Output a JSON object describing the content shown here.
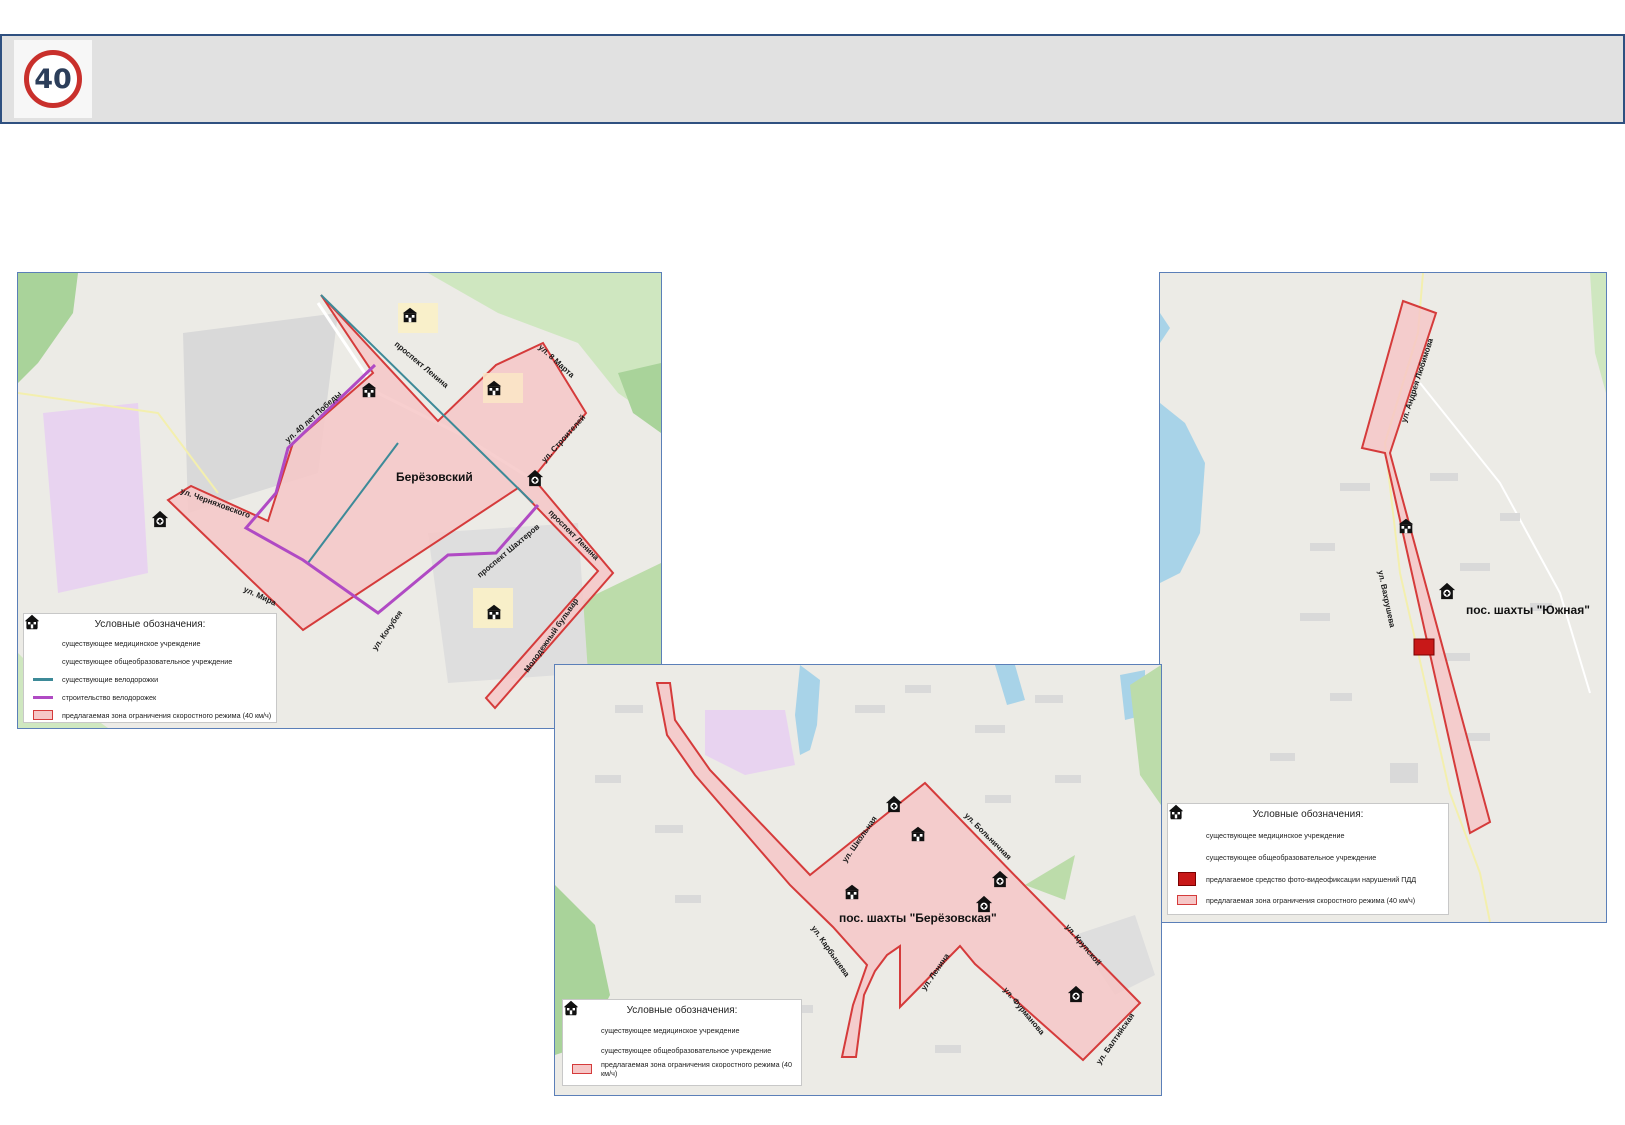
{
  "header": {
    "badge_number": "40",
    "accent_color": "#2f5080",
    "badge_color": "#c9302c"
  },
  "maps": {
    "berezovsky": {
      "place_name": "Берёзовский",
      "streets": {
        "prospekt_lenina_1": "проспект Ленина",
        "ul_8_marta": "ул. 8 Марта",
        "ul_40_let_pobedy": "ул. 40 лет Победы",
        "ul_stroiteley": "ул. Строителей",
        "ul_chernyakhovskogo": "ул. Черняховского",
        "prospekt_lenina_2": "проспект Ленина",
        "prospekt_shakhterov": "проспект Шахтеров",
        "ul_mira": "ул. Мира",
        "ul_kochubeya": "ул. Кочубея",
        "molodezhny_bulvar": "Молодежный бульвар"
      },
      "legend": {
        "title": "Условные обозначения:",
        "medical": "существующее медицинское учреждение",
        "school": "существующее общеобразовательное учреждение",
        "bike_existing": "существующие велодорожки",
        "bike_construction": "строительство велодорожек",
        "zone": "предлагаемая зона ограничения скоростного режима (40 км/ч)"
      }
    },
    "berezovskaya": {
      "place_name": "пос. шахты \"Берёзовская\"",
      "streets": {
        "ul_shkolnaya": "ул. Школьная",
        "ul_bolnichnaya": "ул. Больничная",
        "ul_karbysheva": "ул. Карбышева",
        "ul_krupskoy": "ул. Крупской",
        "ul_lenina": "ул. Ленина",
        "ul_furmanova": "ул. Фурманова",
        "ul_baltiyskaya": "ул. Балтийская"
      },
      "legend": {
        "title": "Условные обозначения:",
        "medical": "существующее медицинское учреждение",
        "school": "существующее общеобразовательное учреждение",
        "zone": "предлагаемая зона ограничения скоростного режима (40 км/ч)"
      }
    },
    "yuzhnaya": {
      "place_name": "пос. шахты \"Южная\"",
      "streets": {
        "ul_andreya_lyubimova": "ул. Андрея Любимова",
        "ul_vakhrusheva": "ул. Вахрушева"
      },
      "legend": {
        "title": "Условные обозначения:",
        "medical": "существующее медицинское учреждение",
        "school": "существующее общеобразовательное учреждение",
        "camera": "предлагаемое средство фото-видеофиксации нарушений ПДД",
        "zone": "предлагаемая зона ограничения скоростного режима (40 км/ч)"
      }
    }
  },
  "colors": {
    "zone_fill": "#f6c7c7",
    "zone_stroke": "#d53b3b",
    "bike_existing": "#3d8a98",
    "bike_construction": "#b04ac4",
    "camera": "#c81818",
    "map_border": "#5b7fb8"
  },
  "icons": {
    "medical": "medical-house-icon",
    "school": "school-building-icon",
    "camera": "speed-camera-icon"
  }
}
